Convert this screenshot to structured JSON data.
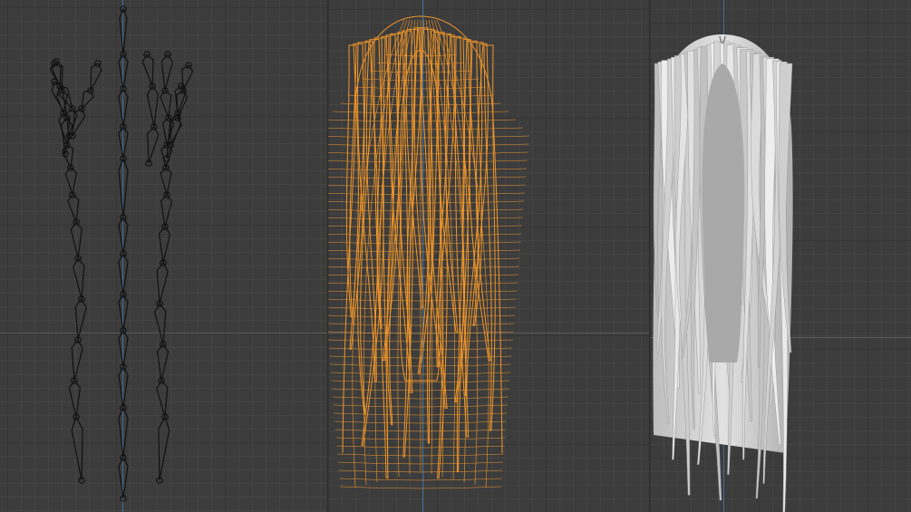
{
  "app": {
    "name": ""
  },
  "viewports": [
    {
      "id": "armature-view",
      "content": "armature-bones",
      "color": "#111111"
    },
    {
      "id": "wireframe-view",
      "content": "hair-wireframe",
      "color": "#f0962a"
    },
    {
      "id": "solid-view",
      "content": "hair-solid",
      "color": "#cfcfcf"
    }
  ],
  "colors": {
    "grid_bg": "#3c3c3c",
    "axis": "#3d6e9e",
    "wire": "#f0962a",
    "solid": "#cfcfcf",
    "bone": "#111111"
  }
}
